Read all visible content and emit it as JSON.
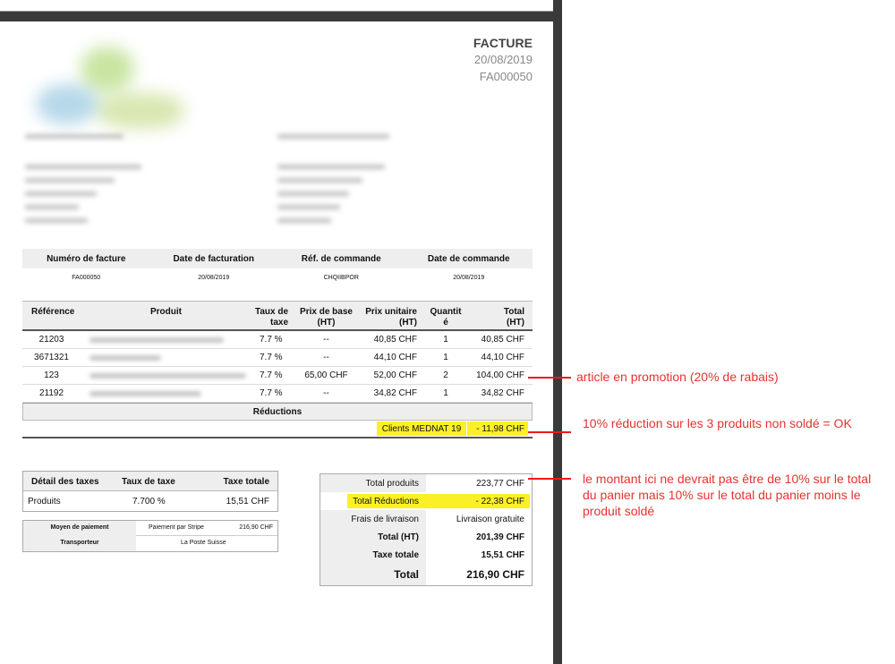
{
  "header": {
    "title": "FACTURE",
    "date": "20/08/2019",
    "number": "FA000050"
  },
  "info_table": {
    "headers": [
      "Numéro de facture",
      "Date de facturation",
      "Réf. de commande",
      "Date de commande"
    ],
    "values": [
      "FA000050",
      "20/08/2019",
      "CHQIIBPOR",
      "20/08/2019"
    ]
  },
  "products": {
    "headers": {
      "reference": "Référence",
      "product": "Produit",
      "tax_rate_1": "Taux de",
      "tax_rate_2": "taxe",
      "base_price_1": "Prix de base",
      "base_price_2": "(HT)",
      "unit_price_1": "Prix unitaire",
      "unit_price_2": "(HT)",
      "qty_1": "Quantit",
      "qty_2": "é",
      "total_1": "Total",
      "total_2": "(HT)"
    },
    "rows": [
      {
        "reference": "21203",
        "tax_rate": "7.7 %",
        "base_price": "--",
        "unit_price": "40,85 CHF",
        "qty": "1",
        "total": "40,85 CHF"
      },
      {
        "reference": "3671321",
        "tax_rate": "7.7 %",
        "base_price": "--",
        "unit_price": "44,10 CHF",
        "qty": "1",
        "total": "44,10 CHF"
      },
      {
        "reference": "123",
        "tax_rate": "7.7 %",
        "base_price": "65,00 CHF",
        "unit_price": "52,00 CHF",
        "qty": "2",
        "total": "104,00 CHF"
      },
      {
        "reference": "21192",
        "tax_rate": "7.7 %",
        "base_price": "--",
        "unit_price": "34,82 CHF",
        "qty": "1",
        "total": "34,82 CHF"
      }
    ],
    "reductions_title": "Réductions",
    "discount": {
      "label": "Clients MEDNAT 19",
      "value": "- 11,98 CHF"
    }
  },
  "tax_detail": {
    "headers": [
      "Détail des taxes",
      "Taux de taxe",
      "Taxe totale"
    ],
    "row": [
      "Produits",
      "7.700 %",
      "15,51 CHF"
    ]
  },
  "payment": {
    "method_label": "Moyen de paiement",
    "method_value": "Paiement par Stripe",
    "method_amount": "216,90 CHF",
    "carrier_label": "Transporteur",
    "carrier_value": "La Poste Suisse"
  },
  "totals": {
    "products_label": "Total produits",
    "products_value": "223,77 CHF",
    "reductions_label": "Total Réductions",
    "reductions_value": "- 22,38 CHF",
    "shipping_label": "Frais de livraison",
    "shipping_value": "Livraison gratuite",
    "total_ht_label": "Total (HT)",
    "total_ht_value": "201,39 CHF",
    "tax_label": "Taxe totale",
    "tax_value": "15,51 CHF",
    "total_label": "Total",
    "total_value": "216,90 CHF"
  },
  "annotations": {
    "promo": "article en promotion (20% de rabais)",
    "discount_ok": "10% réduction sur les 3 produits non soldé = OK",
    "total_wrong": "le montant ici ne devrait pas être de 10% sur le total du panier mais 10% sur le total du panier moins le produit soldé"
  },
  "colors": {
    "highlight": "#fbf027",
    "annotation": "#e3342f"
  }
}
